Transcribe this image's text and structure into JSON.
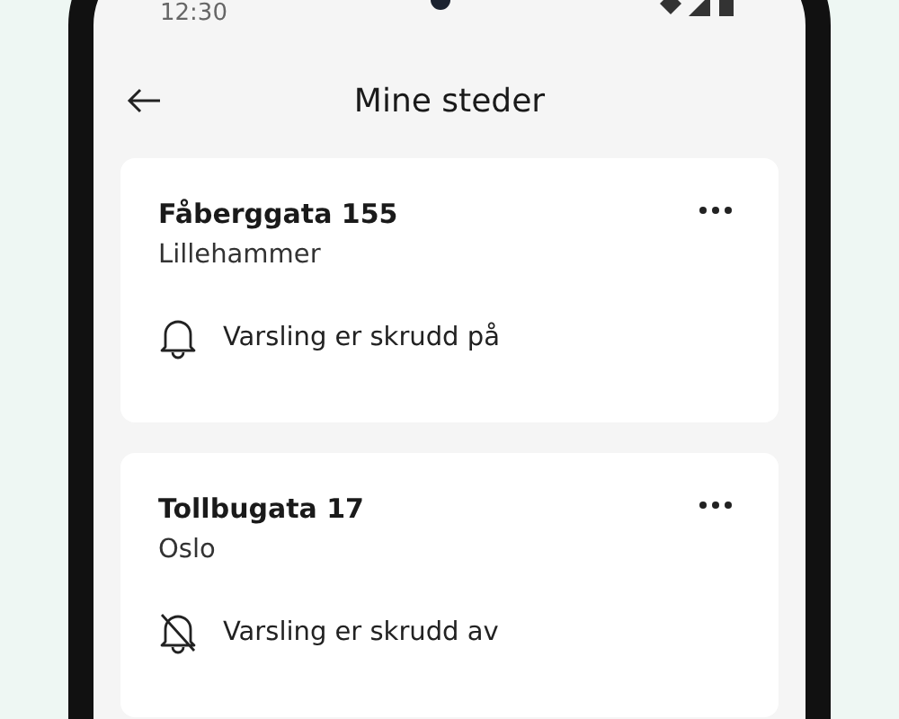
{
  "status_bar": {
    "time": "12:30"
  },
  "header": {
    "title": "Mine steder"
  },
  "places": [
    {
      "address": "Fåberggata 155",
      "city": "Lillehammer",
      "notifications_on": true,
      "notification_text": "Varsling er skrudd på"
    },
    {
      "address": "Tollbugata 17",
      "city": "Oslo",
      "notifications_on": false,
      "notification_text": "Varsling er skrudd av"
    }
  ]
}
